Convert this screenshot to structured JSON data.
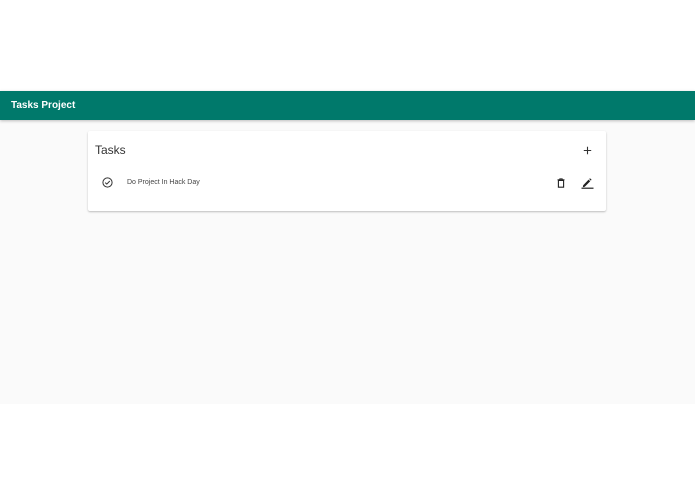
{
  "app_bar": {
    "title": "Tasks Project",
    "color": "#00796b"
  },
  "card": {
    "title": "Tasks",
    "add_icon": "plus-icon"
  },
  "tasks": [
    {
      "label": "Do Project In Hack Day",
      "status_icon": "check-circle-icon",
      "delete_icon": "trash-icon",
      "edit_icon": "pencil-icon"
    }
  ]
}
